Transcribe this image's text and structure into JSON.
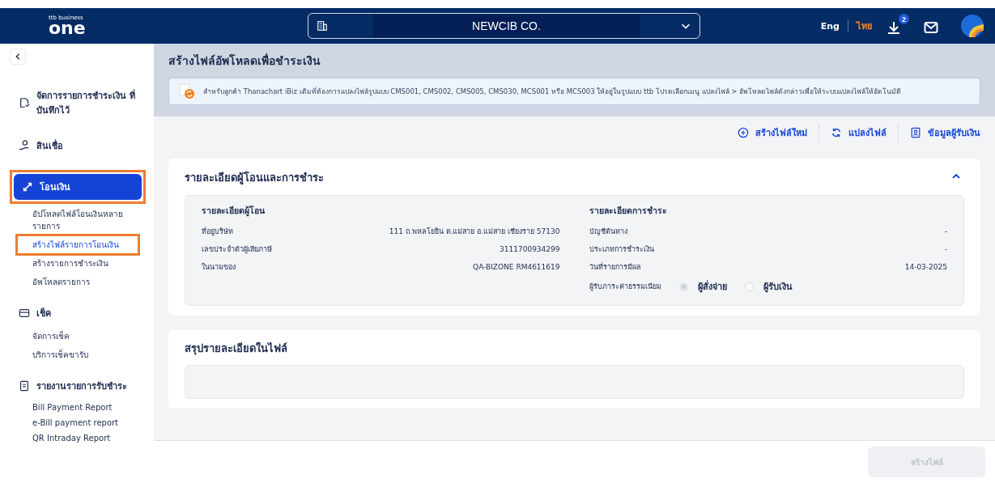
{
  "header": {
    "logo_small": "ttb business",
    "logo": "one",
    "company": "NEWCIB CO.",
    "languages": [
      {
        "label": "Eng",
        "selected": false
      },
      {
        "label": "ไทย",
        "selected": true
      }
    ],
    "download_badge": "2"
  },
  "sidebar": {
    "groups": [
      {
        "label": "จัดการรายการชำระเงิน ที่บันทึกไว้",
        "selected": false,
        "annotated": false
      },
      {
        "label": "สินเชื่อ",
        "selected": false,
        "annotated": false
      },
      {
        "label": "โอนเงิน",
        "selected": true,
        "annotated": true,
        "items": [
          {
            "label": "อัปโหลดไฟล์โอนเงินหลายรายการ",
            "selected": false,
            "annotated": false
          },
          {
            "label": "สร้างไฟล์รายการโอนเงิน",
            "selected": true,
            "annotated": true
          },
          {
            "label": "สร้างรายการชำระเงิน",
            "selected": false,
            "annotated": false
          },
          {
            "label": "อัพโหลดรายการ",
            "selected": false,
            "annotated": false
          }
        ]
      },
      {
        "label": "เช็ค",
        "selected": false,
        "annotated": false,
        "items": [
          {
            "label": "จัดการเช็ค",
            "selected": false,
            "annotated": false
          },
          {
            "label": "บริการเช็คขารับ",
            "selected": false,
            "annotated": false
          }
        ]
      },
      {
        "label": "รายงานรายการรับชำระ",
        "selected": false,
        "annotated": false,
        "items": [
          {
            "label": "Bill Payment Report",
            "selected": false,
            "annotated": false
          },
          {
            "label": "e-Bill payment report",
            "selected": false,
            "annotated": false
          },
          {
            "label": "QR Intraday Report",
            "selected": false,
            "annotated": false
          }
        ]
      }
    ]
  },
  "page": {
    "title": "สร้างไฟล์อัพโหลดเพื่อชำระเงิน",
    "notice": "สำหรับลูกค้า Thanachart iBiz เดิมที่ต้องการแปลงไฟล์รูปแบบ CMS001, CMS002, CMS005, CMS030, MCS001 หรือ MCS003 ให้อยู่ในรูปแบบ ttb โปรดเลือกเมนู แปลงไฟล์ > อัพโหลดไฟล์ดังกล่าวเพื่อให้ระบบแปลงไฟล์ให้อัตโนมัติ",
    "actions": [
      {
        "label": "สร้างไฟล์ใหม่"
      },
      {
        "label": "แปลงไฟล์"
      },
      {
        "label": "ข้อมูลผู้รับเงิน"
      }
    ]
  },
  "details_card": {
    "title": "รายละเอียดผู้โอนและการชำระ",
    "expanded": true,
    "left": {
      "heading": "รายละเอียดผู้โอน",
      "rows": [
        {
          "label": "ที่อยู่บริษัท",
          "value": "111 ถ.พหลโยธิน ต.แม่สาย อ.แม่สาย เชียงราย 57130"
        },
        {
          "label": "เลขประจำตัวผู้เสียภาษี",
          "value": "3111700934299"
        },
        {
          "label": "ในนามของ",
          "value": "QA-BIZONE RM4611619"
        }
      ]
    },
    "right": {
      "heading": "รายละเอียดการชำระ",
      "rows": [
        {
          "label": "บัญชีต้นทาง",
          "value": "-"
        },
        {
          "label": "ประเภทการชำระเงิน",
          "value": "-"
        },
        {
          "label": "วันที่รายการมีผล",
          "value": "14-03-2025"
        }
      ]
    },
    "fee_label": "ผู้รับภาระค่าธรรมเนียม",
    "fee_options": [
      {
        "label": "ผู้สั่งจ่าย",
        "selected": true,
        "disabled": true
      },
      {
        "label": "ผู้รับเงิน",
        "selected": false,
        "disabled": true
      }
    ]
  },
  "summary_card": {
    "title": "สรุปรายละเอียดในไฟล์"
  },
  "footer": {
    "button": {
      "label": "สร้างไฟล์",
      "disabled": true
    }
  }
}
